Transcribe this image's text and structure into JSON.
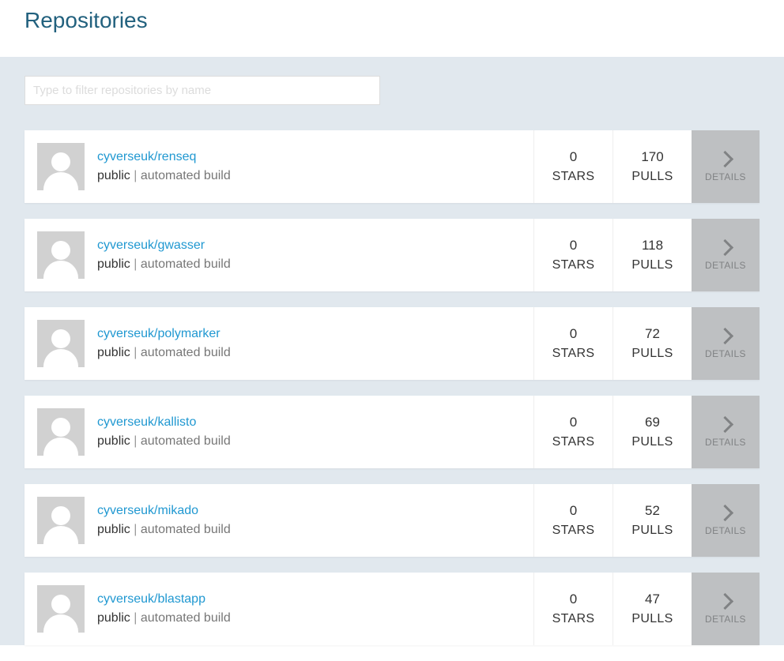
{
  "header": {
    "title": "Repositories"
  },
  "filter": {
    "placeholder": "Type to filter repositories by name",
    "value": ""
  },
  "labels": {
    "stars": "STARS",
    "pulls": "PULLS",
    "details": "DETAILS",
    "separator": " | "
  },
  "repos": [
    {
      "name": "cyverseuk/renseq",
      "visibility": "public",
      "build": "automated build",
      "stars": "0",
      "pulls": "170"
    },
    {
      "name": "cyverseuk/gwasser",
      "visibility": "public",
      "build": "automated build",
      "stars": "0",
      "pulls": "118"
    },
    {
      "name": "cyverseuk/polymarker",
      "visibility": "public",
      "build": "automated build",
      "stars": "0",
      "pulls": "72"
    },
    {
      "name": "cyverseuk/kallisto",
      "visibility": "public",
      "build": "automated build",
      "stars": "0",
      "pulls": "69"
    },
    {
      "name": "cyverseuk/mikado",
      "visibility": "public",
      "build": "automated build",
      "stars": "0",
      "pulls": "52"
    },
    {
      "name": "cyverseuk/blastapp",
      "visibility": "public",
      "build": "automated build",
      "stars": "0",
      "pulls": "47"
    }
  ]
}
